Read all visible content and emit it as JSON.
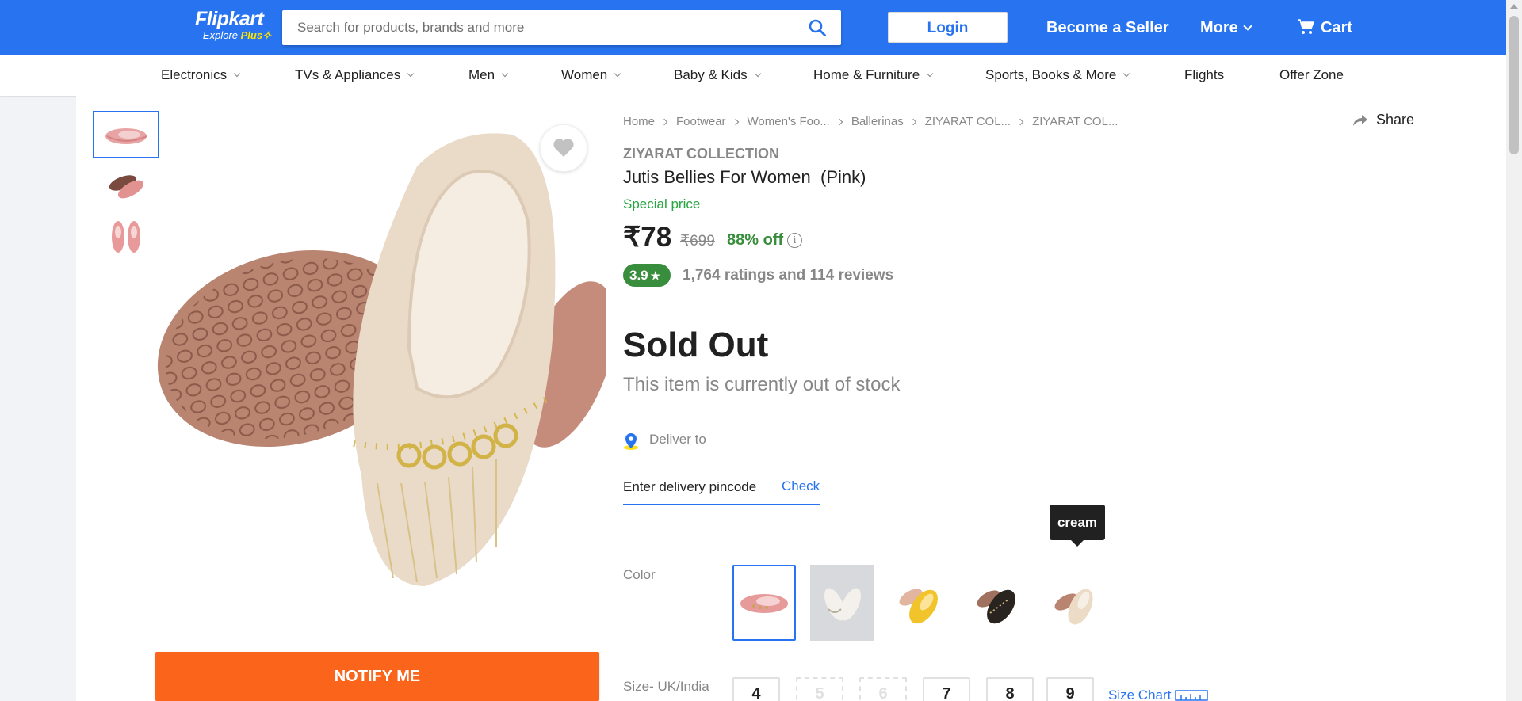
{
  "header": {
    "logo_text": "Flipkart",
    "logo_subtext": "Explore",
    "logo_plus": "Plus",
    "search_placeholder": "Search for products, brands and more",
    "login_label": "Login",
    "seller_label": "Become a Seller",
    "more_label": "More",
    "cart_label": "Cart",
    "brand_color": "#2874f0"
  },
  "categories": [
    "Electronics",
    "TVs & Appliances",
    "Men",
    "Women",
    "Baby & Kids",
    "Home & Furniture",
    "Sports, Books & More",
    "Flights",
    "Offer Zone"
  ],
  "breadcrumbs": [
    "Home",
    "Footwear",
    "Women's Foo...",
    "Ballerinas",
    "ZIYARAT COL...",
    "ZIYARAT COL..."
  ],
  "share_label": "Share",
  "product": {
    "brand": "ZIYARAT COLLECTION",
    "title": "Jutis Bellies For Women  (Pink)",
    "special_price_label": "Special price",
    "price": "₹78",
    "mrp": "₹699",
    "discount": "88% off",
    "rating": "3.9",
    "rating_summary": "1,764 ratings and 114 reviews",
    "stock_status": "Sold Out",
    "stock_message": "This item is currently out of stock"
  },
  "delivery": {
    "label": "Deliver to",
    "pincode_placeholder": "Enter delivery pincode",
    "check_label": "Check"
  },
  "color": {
    "label": "Color",
    "tooltip": "cream",
    "swatches": [
      "pink",
      "white",
      "yellow",
      "black",
      "cream"
    ],
    "selected": "pink"
  },
  "size": {
    "label": "Size- UK/India",
    "options": [
      "4",
      "5",
      "6",
      "7",
      "8",
      "9"
    ],
    "unavailable": [
      "5",
      "6"
    ],
    "chart_label": "Size Chart"
  },
  "notify_label": "NOTIFY ME",
  "colors": {
    "accent": "#2874f0",
    "notify": "#fb641b",
    "rating_green": "#388e3c",
    "special_green": "#26a541"
  }
}
